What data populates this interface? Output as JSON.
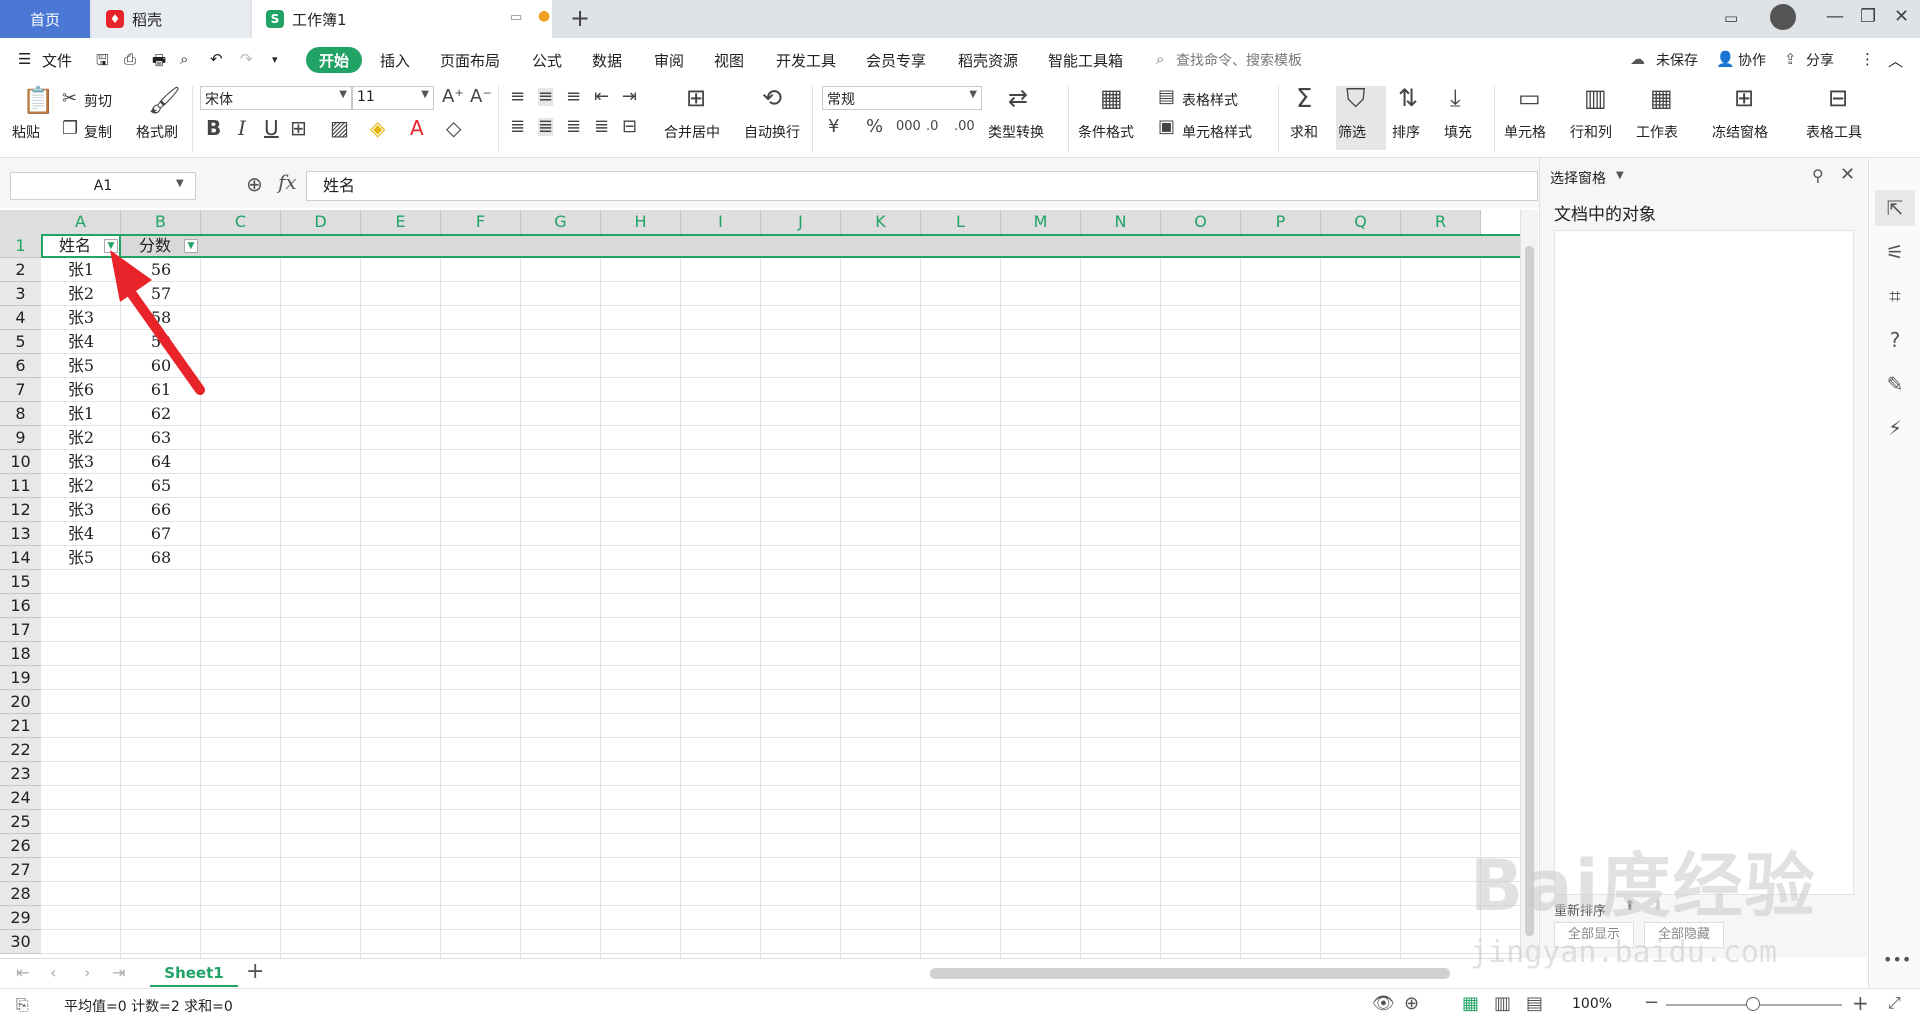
{
  "tabs": {
    "home": "首页",
    "daoke": "稻壳",
    "workbook": "工作簿1"
  },
  "menu": {
    "file": "文件",
    "items": [
      "开始",
      "插入",
      "页面布局",
      "公式",
      "数据",
      "审阅",
      "视图",
      "开发工具",
      "会员专享",
      "稻壳资源",
      "智能工具箱"
    ],
    "search_placeholder": "查找命令、搜索模板",
    "unsaved": "未保存",
    "collab": "协作",
    "share": "分享"
  },
  "ribbon": {
    "paste": "粘贴",
    "cut": "剪切",
    "copy": "复制",
    "format_painter": "格式刷",
    "font_name": "宋体",
    "font_size": "11",
    "merge_center": "合并居中",
    "wrap_text": "自动换行",
    "number_format": "常规",
    "type_convert": "类型转换",
    "cond_format": "条件格式",
    "table_style": "表格样式",
    "cell_style": "单元格样式",
    "sum": "求和",
    "filter": "筛选",
    "sort": "排序",
    "fill": "填充",
    "cell": "单元格",
    "row_col": "行和列",
    "worksheet": "工作表",
    "freeze": "冻结窗格",
    "table_tools": "表格工具"
  },
  "formula_bar": {
    "name_box": "A1",
    "fx": "fx",
    "content": "姓名"
  },
  "columns": [
    "A",
    "B",
    "C",
    "D",
    "E",
    "F",
    "G",
    "H",
    "I",
    "J",
    "K",
    "L",
    "M",
    "N",
    "O",
    "P",
    "Q",
    "R"
  ],
  "rows": [
    "1",
    "2",
    "3",
    "4",
    "5",
    "6",
    "7",
    "8",
    "9",
    "10",
    "11",
    "12",
    "13",
    "14",
    "15",
    "16",
    "17",
    "18",
    "19",
    "20",
    "21",
    "22",
    "23",
    "24",
    "25",
    "26",
    "27",
    "28",
    "29",
    "30"
  ],
  "table": {
    "headers": [
      "姓名",
      "分数"
    ],
    "rows": [
      [
        "张1",
        "56"
      ],
      [
        "张2",
        "57"
      ],
      [
        "张3",
        "58"
      ],
      [
        "张4",
        "59"
      ],
      [
        "张5",
        "60"
      ],
      [
        "张6",
        "61"
      ],
      [
        "张1",
        "62"
      ],
      [
        "张2",
        "63"
      ],
      [
        "张3",
        "64"
      ],
      [
        "张2",
        "65"
      ],
      [
        "张3",
        "66"
      ],
      [
        "张4",
        "67"
      ],
      [
        "张5",
        "68"
      ]
    ]
  },
  "pane": {
    "title": "选择窗格",
    "subtitle": "文档中的对象",
    "btn_show_all": "全部显示",
    "btn_hide_all": "全部隐藏",
    "reorder": "重新排序"
  },
  "sheet": {
    "name": "Sheet1"
  },
  "status": {
    "summary": "平均值=0  计数=2  求和=0",
    "zoom": "100%"
  },
  "watermark": {
    "brand": "Bai度经验",
    "url": "jingyan.baidu.com"
  },
  "colors": {
    "accent": "#21a366",
    "arrow": "#e8232a",
    "home_tab": "#4a78d4"
  }
}
